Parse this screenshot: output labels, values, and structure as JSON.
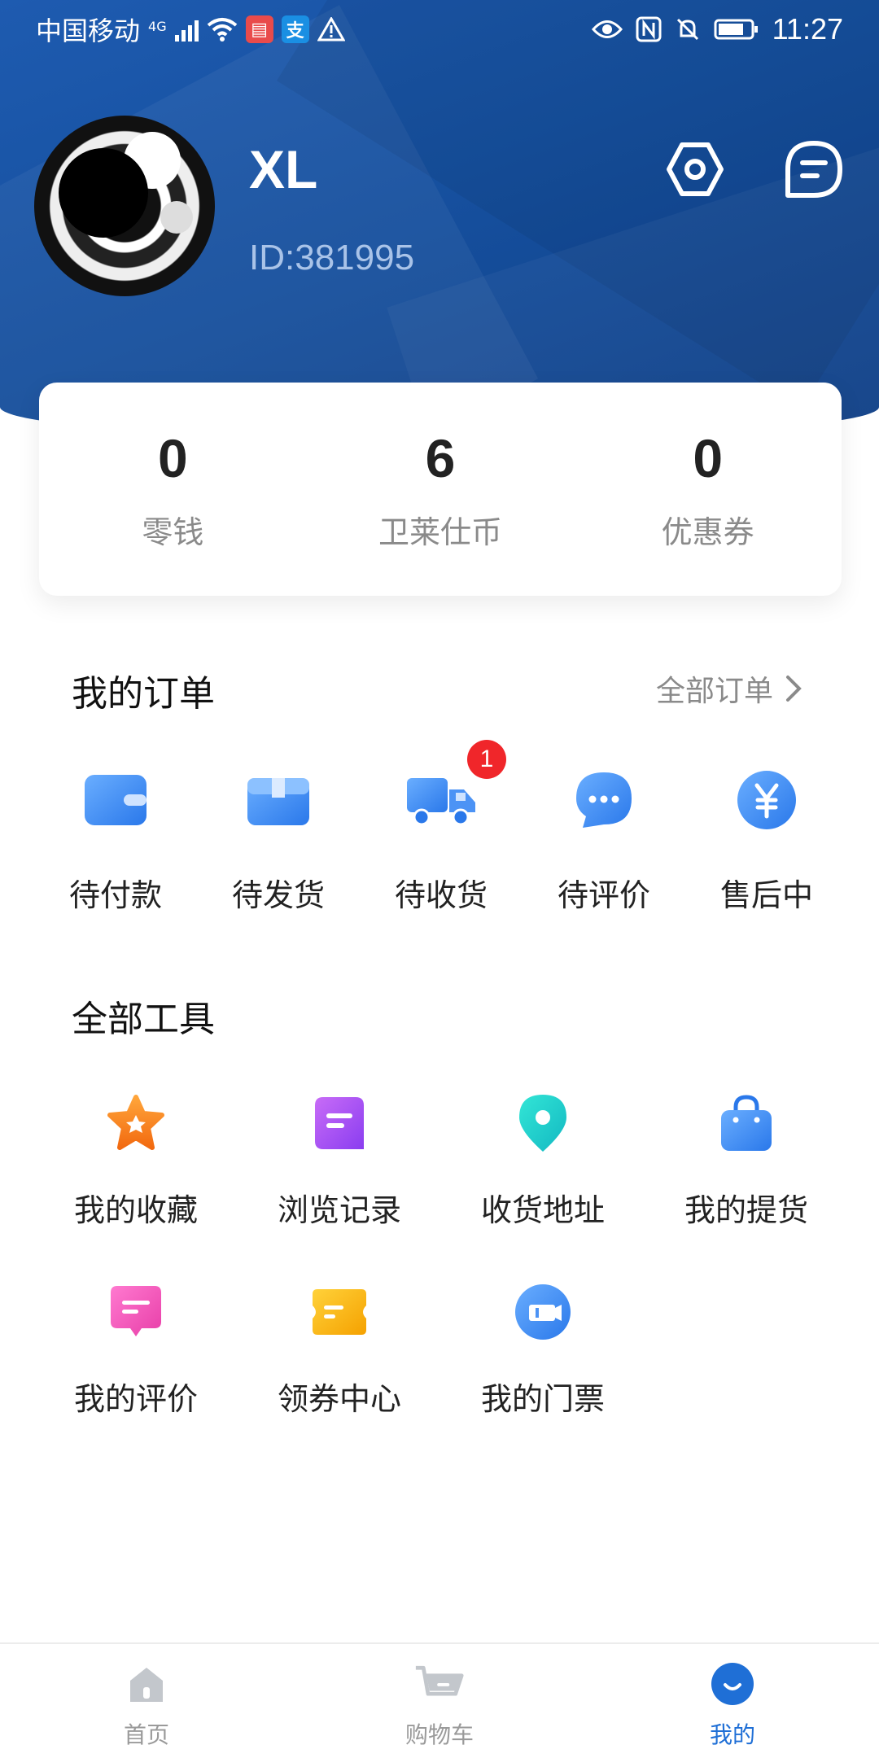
{
  "status_bar": {
    "carrier": "中国移动",
    "network": "4G",
    "time": "11:27"
  },
  "profile": {
    "username": "XL",
    "user_id": "ID:381995"
  },
  "stats": [
    {
      "value": "0",
      "label": "零钱"
    },
    {
      "value": "6",
      "label": "卫莱仕币"
    },
    {
      "value": "0",
      "label": "优惠券"
    }
  ],
  "orders": {
    "title": "我的订单",
    "all_link": "全部订单",
    "items": [
      {
        "label": "待付款",
        "icon": "wallet-icon"
      },
      {
        "label": "待发货",
        "icon": "package-icon"
      },
      {
        "label": "待收货",
        "icon": "truck-icon",
        "badge": "1"
      },
      {
        "label": "待评价",
        "icon": "chat-bubble-icon"
      },
      {
        "label": "售后中",
        "icon": "yuan-coin-icon"
      }
    ]
  },
  "tools": {
    "title": "全部工具",
    "items": [
      {
        "label": "我的收藏",
        "icon": "star-icon"
      },
      {
        "label": "浏览记录",
        "icon": "history-icon"
      },
      {
        "label": "收货地址",
        "icon": "location-pin-icon"
      },
      {
        "label": "我的提货",
        "icon": "shopping-bag-icon"
      },
      {
        "label": "我的评价",
        "icon": "review-icon"
      },
      {
        "label": "领券中心",
        "icon": "coupon-icon"
      },
      {
        "label": "我的门票",
        "icon": "ticket-icon"
      }
    ]
  },
  "bottom_nav": [
    {
      "label": "首页",
      "icon": "home-icon",
      "active": false
    },
    {
      "label": "购物车",
      "icon": "cart-icon",
      "active": false
    },
    {
      "label": "我的",
      "icon": "profile-icon",
      "active": true
    }
  ],
  "colors": {
    "header_blue": "#16509f",
    "accent_blue": "#1f6fd6",
    "badge_red": "#f0262a"
  }
}
